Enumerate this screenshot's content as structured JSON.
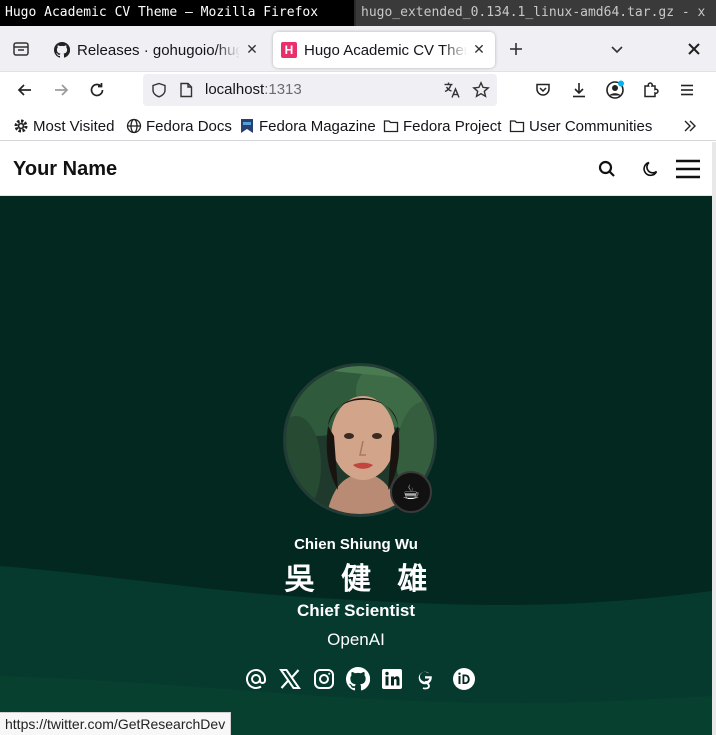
{
  "os": {
    "active_window_title": "Hugo Academic CV Theme — Mozilla Firefox",
    "other_window_title": "hugo_extended_0.134.1_linux-amd64.tar.gz - x"
  },
  "tabs": [
    {
      "label": "Releases · gohugoio/hugo",
      "icon": "github-icon",
      "active": false
    },
    {
      "label": "Hugo Academic CV Theme",
      "icon": "hugo-favicon",
      "active": true
    }
  ],
  "hugo_favicon_letter": "H",
  "address": {
    "host": "localhost",
    "port": ":1313"
  },
  "bookmarks": [
    {
      "label": "Most Visited",
      "icon": "gear-icon"
    },
    {
      "label": "Fedora Docs",
      "icon": "globe-icon"
    },
    {
      "label": "Fedora Magazine",
      "icon": "fedora-magazine-icon"
    },
    {
      "label": "Fedora Project",
      "icon": "folder-icon"
    },
    {
      "label": "User Communities",
      "icon": "folder-icon"
    }
  ],
  "site": {
    "title": "Your Name"
  },
  "profile": {
    "name": "Chien Shiung Wu",
    "name_native": "吳 健 雄",
    "role": "Chief Scientist",
    "organization": "OpenAI",
    "status_emoji": "☕",
    "social_icons": [
      "at-icon",
      "x-twitter-icon",
      "instagram-icon",
      "github-icon",
      "linkedin-icon",
      "google-scholar-icon",
      "orcid-icon"
    ]
  },
  "status_bar": "https://twitter.com/GetResearchDev",
  "colors": {
    "hero_bg": "#032820",
    "wave": "#07382c",
    "hugo_pink": "#e8306d"
  }
}
